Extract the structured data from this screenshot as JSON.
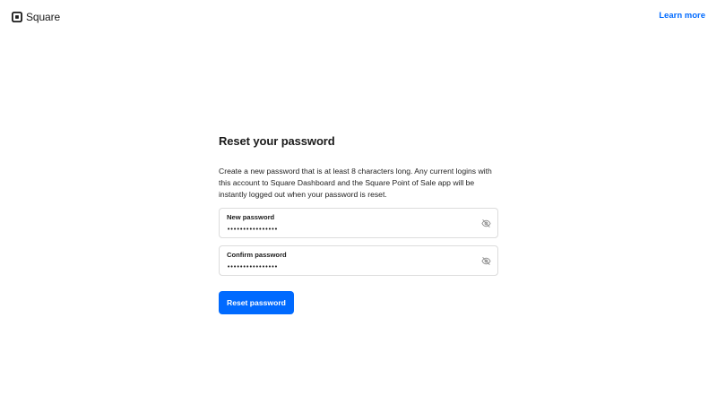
{
  "header": {
    "brand": "Square",
    "learn_more": "Learn more"
  },
  "form": {
    "title": "Reset your password",
    "description": "Create a new password that is at least 8 characters long. Any current logins with this account to Square Dashboard and the Square Point of Sale app will be instantly logged out when your password is reset.",
    "new_password": {
      "label": "New password",
      "value": "••••••••••••••••",
      "toggle_icon": "eye-off-icon"
    },
    "confirm_password": {
      "label": "Confirm password",
      "value": "••••••••••••••••",
      "toggle_icon": "eye-off-icon"
    },
    "submit_label": "Reset password"
  },
  "colors": {
    "accent": "#006aff",
    "border": "#dcdcdc",
    "text": "#1a1a1a",
    "icon": "#8a8a8a"
  }
}
